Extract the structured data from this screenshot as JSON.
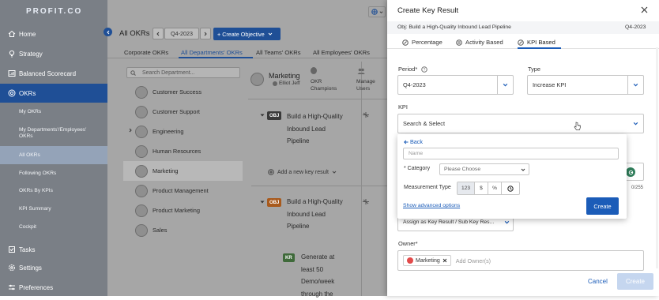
{
  "app": {
    "logo": "PROFIT.CO"
  },
  "sidebar": {
    "items": [
      {
        "label": "Home",
        "icon": "home-icon"
      },
      {
        "label": "Strategy",
        "icon": "lightbulb-icon"
      },
      {
        "label": "Balanced Scorecard",
        "icon": "scorecard-icon"
      },
      {
        "label": "OKRs",
        "icon": "target-icon"
      }
    ],
    "sub_items": [
      {
        "label": "My OKRs"
      },
      {
        "label": "My Departments'/Employees' OKRs"
      },
      {
        "label": "All OKRs"
      },
      {
        "label": "Following OKRs"
      },
      {
        "label": "OKRs By KPIs"
      },
      {
        "label": "KPI Summary"
      },
      {
        "label": "Cockpit"
      }
    ],
    "bottom_items": [
      {
        "label": "Tasks"
      },
      {
        "label": "Settings"
      },
      {
        "label": "Preferences"
      }
    ]
  },
  "main": {
    "title": "All OKRs",
    "period": "Q4-2023",
    "create_objective_label": "+ Create Objective",
    "tabs": [
      "Corporate OKRs",
      "All Departments' OKRs",
      "All Teams' OKRs",
      "All Employees' OKRs"
    ],
    "search_placeholder": "Search Department...",
    "departments": [
      "Customer Success",
      "Customer Support",
      "Engineering",
      "Human Resources",
      "Marketing",
      "Product Management",
      "Product Marketing",
      "Sales"
    ],
    "selected_department": "Marketing",
    "owner_name": "Elliot Jeff",
    "champions_label": "OKR Champions",
    "manage_users_label": "Manage Users",
    "objectives": [
      {
        "badge": "OBJ",
        "title": "Build a High-Quality Inbound Lead Pipeline",
        "lines": [
          "Build a High-Quality",
          "Inbound Lead",
          "Pipeline"
        ]
      },
      {
        "badge": "OBJ",
        "title": "Build a High-Quality Inbound Lead Pipeline",
        "lines": [
          "Build a High-Quality",
          "Inbound Lead",
          "Pipeline"
        ]
      }
    ],
    "add_key_result_label": "Add a new key result",
    "key_result": {
      "badge": "KR",
      "lines": [
        "Generate at",
        "least 50",
        "Demo/week",
        "through the"
      ]
    }
  },
  "panel": {
    "title": "Create Key Result",
    "objective_label": "Obj: Build a High-Quality Inbound Lead Pipeline",
    "period_badge": "Q4-2023",
    "tabs": [
      "Percentage",
      "Activity Based",
      "KPI Based"
    ],
    "period_label": "Period*",
    "period_value": "Q4-2023",
    "type_label": "Type",
    "type_value": "Increase KPI",
    "kpi_label": "KPI",
    "kpi_placeholder": "Search & Select",
    "counter": "0/255",
    "assign_value": "Assign as Key Result / Sub Key Res...",
    "owner_label": "Owner*",
    "owner_chip": "Marketing",
    "add_owner_placeholder": "Add Owner(s)",
    "cancel_label": "Cancel",
    "create_label": "Create",
    "accent": "#1b5cb8"
  },
  "kpi_popup": {
    "back_label": "Back",
    "name_placeholder": "Name",
    "category_label": "Category",
    "category_placeholder": "Please Choose",
    "measurement_label": "Measurement Type",
    "measurement_options": [
      "123",
      "$",
      "%",
      "clock"
    ],
    "advanced_link": "Show advanced options",
    "create_label": "Create"
  }
}
